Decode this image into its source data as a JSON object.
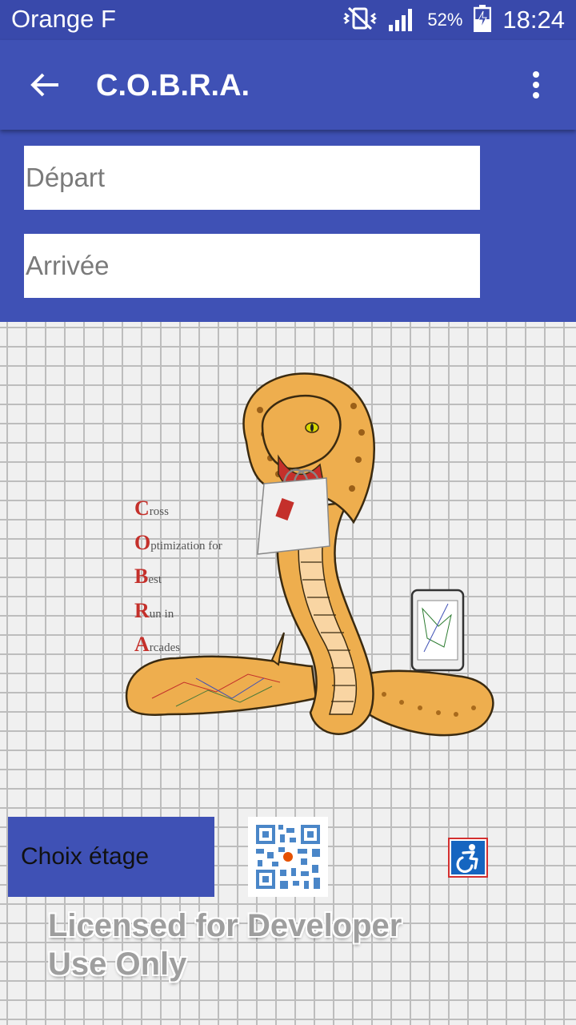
{
  "status_bar": {
    "carrier": "Orange F",
    "battery_percent": "52%",
    "time": "18:24",
    "icons": [
      "vibrate-icon",
      "signal-icon",
      "battery-charging-icon"
    ]
  },
  "app_bar": {
    "title": "C.O.B.R.A.",
    "back_icon": "arrow-back-icon",
    "menu_icon": "more-vert-icon"
  },
  "form": {
    "depart_placeholder": "Départ",
    "arrivee_placeholder": "Arrivée",
    "depart_value": "",
    "arrivee_value": ""
  },
  "logo": {
    "acronym": [
      {
        "initial": "C",
        "rest": "ross"
      },
      {
        "initial": "O",
        "rest": "ptimization for"
      },
      {
        "initial": "B",
        "rest": "est"
      },
      {
        "initial": "R",
        "rest": "un in"
      },
      {
        "initial": "A",
        "rest": "rcades"
      }
    ]
  },
  "bottom": {
    "floor_button_label": "Choix étage",
    "license_line1": "Licensed for Developer",
    "license_line2": "Use Only"
  },
  "colors": {
    "primary": "#3f51b5",
    "status_bar": "#3949ab",
    "snake": "#e8a849",
    "accent_red": "#c4302b"
  }
}
